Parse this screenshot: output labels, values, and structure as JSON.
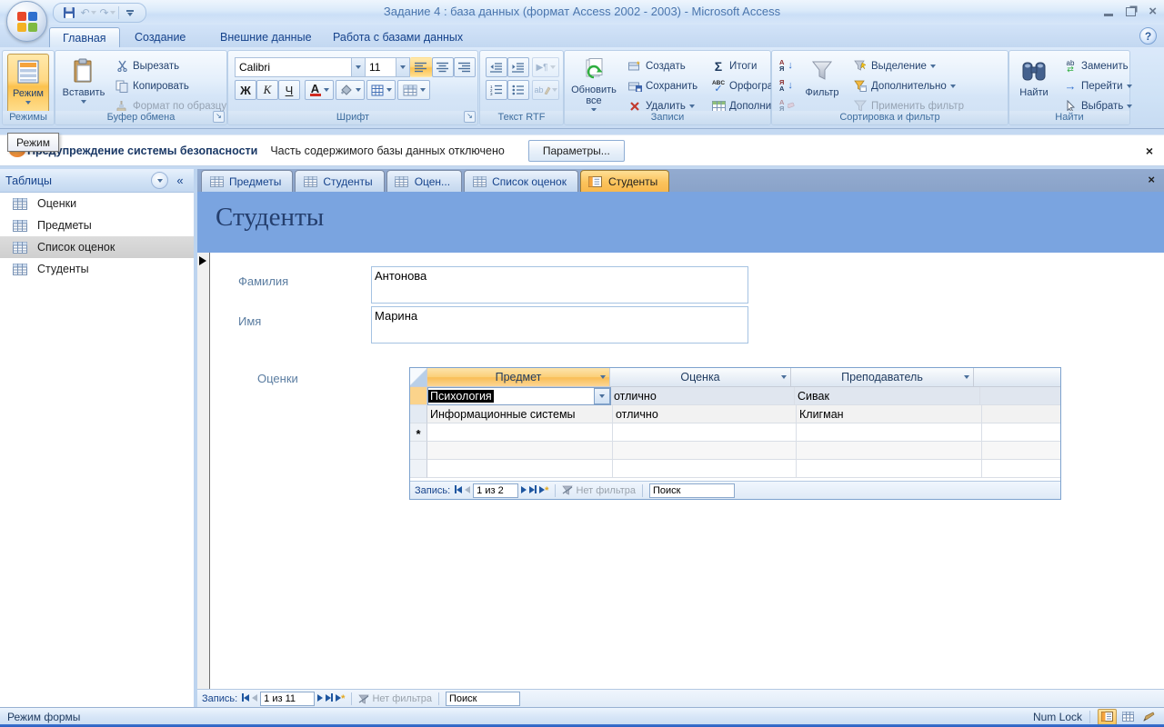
{
  "window": {
    "title": "Задание 4 : база данных (формат Access 2002 - 2003)  -  Microsoft Access",
    "help": "?"
  },
  "ribbon": {
    "tabs": [
      {
        "label": "Главная"
      },
      {
        "label": "Создание"
      },
      {
        "label": "Внешние данные"
      },
      {
        "label": "Работа с базами данных"
      }
    ],
    "modes": {
      "button": "Режим",
      "group": "Режимы"
    },
    "clipboard": {
      "paste": "Вставить",
      "cut": "Вырезать",
      "copy": "Копировать",
      "format_painter": "Формат по образцу",
      "group": "Буфер обмена"
    },
    "font": {
      "name": "Calibri",
      "size": "11",
      "bold": "Ж",
      "italic": "К",
      "underline": "Ч",
      "color": "А",
      "group": "Шрифт"
    },
    "rtf": {
      "highlight": "ab",
      "group": "Текст RTF"
    },
    "records": {
      "refresh": "Обновить все",
      "create": "Создать",
      "save": "Сохранить",
      "delete": "Удалить",
      "totals": "Итоги",
      "totals_icon": "Σ",
      "spelling": "Орфография",
      "spelling_icon": "ABC",
      "more": "Дополнительно",
      "group": "Записи"
    },
    "sort": {
      "letter_a": "А",
      "letter_z": "Я",
      "filter": "Фильтр",
      "selection": "Выделение",
      "advanced": "Дополнительно",
      "apply": "Применить фильтр",
      "group": "Сортировка и фильтр"
    },
    "find": {
      "find": "Найти",
      "replace": "Заменить",
      "replace_icon": "ab",
      "goto": "Перейти",
      "select": "Выбрать",
      "group": "Найти"
    }
  },
  "tooltip": {
    "text": "Режим"
  },
  "security": {
    "title": "Предупреждение системы безопасности",
    "message": "Часть содержимого базы данных отключено",
    "button": "Параметры...",
    "close_icon": "×"
  },
  "nav_pane": {
    "header": "Таблицы",
    "collapse_icon": "«",
    "items": [
      "Оценки",
      "Предметы",
      "Список оценок",
      "Студенты"
    ]
  },
  "doc_tabs": {
    "tabs": [
      "Предметы",
      "Студенты",
      "Оцен...",
      "Список оценок",
      "Студенты"
    ],
    "close_icon": "×"
  },
  "form": {
    "title": "Студенты",
    "label_lastname": "Фамилия",
    "value_lastname": "Антонова",
    "label_firstname": "Имя",
    "value_firstname": "Марина",
    "label_subform": "Оценки"
  },
  "datasheet": {
    "columns": [
      "Предмет",
      "Оценка",
      "Преподаватель"
    ],
    "rows": [
      [
        "Психология",
        "отлично",
        "Сивак"
      ],
      [
        "Информационные системы",
        "отлично",
        "Клигман"
      ]
    ],
    "new_record_icon": "*"
  },
  "subform_nav": {
    "label": "Запись:",
    "position": "1 из 2",
    "no_filter": "Нет фильтра",
    "search": "Поиск"
  },
  "main_nav": {
    "label": "Запись:",
    "position": "1 из 11",
    "no_filter": "Нет фильтра",
    "search": "Поиск"
  },
  "status": {
    "mode": "Режим формы",
    "numlock": "Num Lock"
  }
}
